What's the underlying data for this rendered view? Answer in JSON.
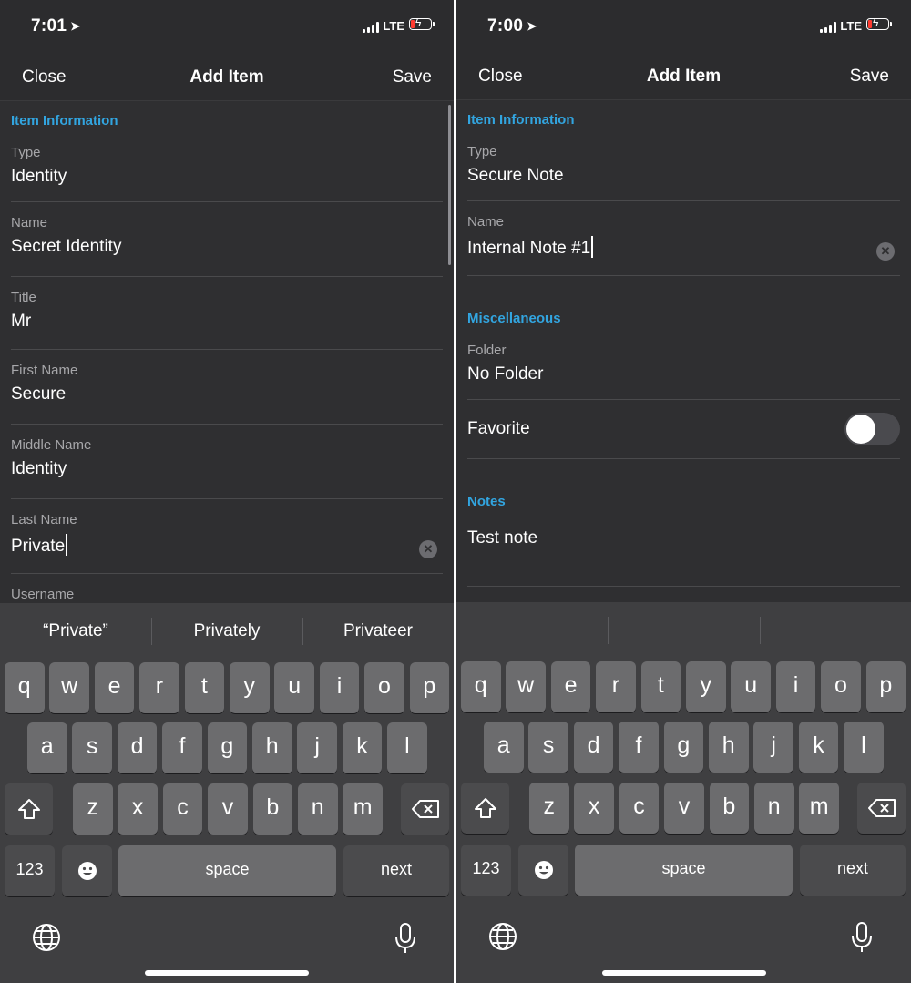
{
  "left": {
    "status": {
      "time": "7:01",
      "network": "LTE"
    },
    "nav": {
      "close": "Close",
      "title": "Add Item",
      "save": "Save"
    },
    "section_item": "Item Information",
    "fields": [
      {
        "label": "Type",
        "value": "Identity"
      },
      {
        "label": "Name",
        "value": "Secret Identity"
      },
      {
        "label": "Title",
        "value": "Mr"
      },
      {
        "label": "First Name",
        "value": "Secure"
      },
      {
        "label": "Middle Name",
        "value": "Identity"
      },
      {
        "label": "Last Name",
        "value": "Private"
      },
      {
        "label": "Username",
        "value": ""
      }
    ],
    "suggestions": [
      "“Private”",
      "Privately",
      "Privateer"
    ]
  },
  "right": {
    "status": {
      "time": "7:00",
      "network": "LTE"
    },
    "nav": {
      "close": "Close",
      "title": "Add Item",
      "save": "Save"
    },
    "section_item": "Item Information",
    "fields": [
      {
        "label": "Type",
        "value": "Secure Note"
      },
      {
        "label": "Name",
        "value": "Internal Note #1"
      }
    ],
    "section_misc": "Miscellaneous",
    "folder": {
      "label": "Folder",
      "value": "No Folder"
    },
    "favorite": {
      "label": "Favorite",
      "on": false
    },
    "section_notes": "Notes",
    "notes": "Test note",
    "suggestions": [
      "",
      "",
      ""
    ]
  },
  "keyboard": {
    "row1": [
      "q",
      "w",
      "e",
      "r",
      "t",
      "y",
      "u",
      "i",
      "o",
      "p"
    ],
    "row2": [
      "a",
      "s",
      "d",
      "f",
      "g",
      "h",
      "j",
      "k",
      "l"
    ],
    "row3": [
      "z",
      "x",
      "c",
      "v",
      "b",
      "n",
      "m"
    ],
    "numbers_label": "123",
    "space_label": "space",
    "next_label": "next"
  },
  "colors": {
    "accent": "#32a5e0",
    "background": "#2f2f31",
    "battery_low": "#ff3b30"
  }
}
